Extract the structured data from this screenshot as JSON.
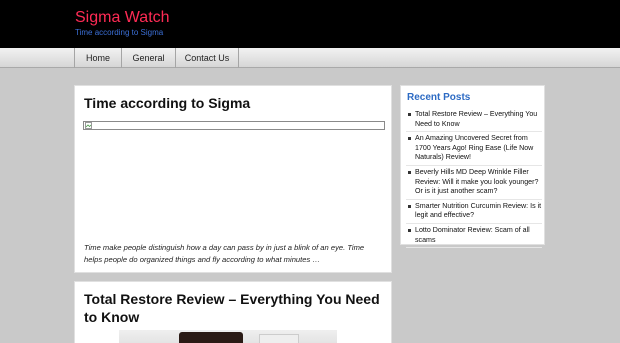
{
  "site": {
    "title": "Sigma Watch",
    "tagline": "Time according to Sigma"
  },
  "nav": {
    "items": [
      "Home",
      "General",
      "Contact Us"
    ]
  },
  "posts": [
    {
      "title": "Time according to Sigma",
      "excerpt": "Time make people distinguish how a day can pass by in just a blink of an eye. Time helps people do organized things and fly according to what minutes …"
    },
    {
      "title": "Total Restore Review – Everything You Need to Know"
    }
  ],
  "sidebar": {
    "title": "Recent Posts",
    "items": [
      "Total Restore Review – Everything You Need to Know",
      "An Amazing Uncovered Secret from 1700 Years Ago! Ring Ease (Life Now Naturals) Review!",
      "Beverly Hills MD Deep Wrinkle Filler Review: Will it make you look younger? Or is it just another scam?",
      "Smarter Nutrition Curcumin Review: Is it legit and effective?",
      "Lotto Dominator Review: Scam of all scams"
    ]
  },
  "colors": {
    "title": "#ff2b55",
    "tagline": "#3b6fd6",
    "sidebar_heading": "#2d6bc4",
    "page_bg": "#c9c9c9"
  }
}
